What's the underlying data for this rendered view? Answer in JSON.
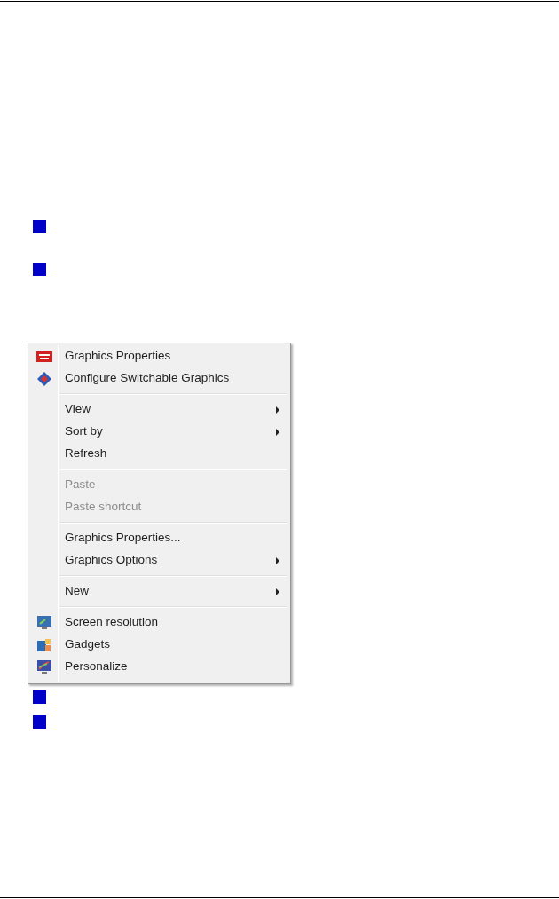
{
  "context_menu": {
    "groups": [
      {
        "items": [
          {
            "label": "Graphics Properties",
            "disabled": false,
            "submenu": false
          },
          {
            "label": "Configure Switchable Graphics",
            "disabled": false,
            "submenu": false
          }
        ]
      },
      {
        "items": [
          {
            "label": "View",
            "disabled": false,
            "submenu": true
          },
          {
            "label": "Sort by",
            "disabled": false,
            "submenu": true
          },
          {
            "label": "Refresh",
            "disabled": false,
            "submenu": false
          }
        ]
      },
      {
        "items": [
          {
            "label": "Paste",
            "disabled": true,
            "submenu": false
          },
          {
            "label": "Paste shortcut",
            "disabled": true,
            "submenu": false
          }
        ]
      },
      {
        "items": [
          {
            "label": "Graphics Properties...",
            "disabled": false,
            "submenu": false
          },
          {
            "label": "Graphics Options",
            "disabled": false,
            "submenu": true
          }
        ]
      },
      {
        "items": [
          {
            "label": "New",
            "disabled": false,
            "submenu": true
          }
        ]
      },
      {
        "items": [
          {
            "label": "Screen resolution",
            "disabled": false,
            "submenu": false
          },
          {
            "label": "Gadgets",
            "disabled": false,
            "submenu": false
          },
          {
            "label": "Personalize",
            "disabled": false,
            "submenu": false
          }
        ]
      }
    ]
  }
}
